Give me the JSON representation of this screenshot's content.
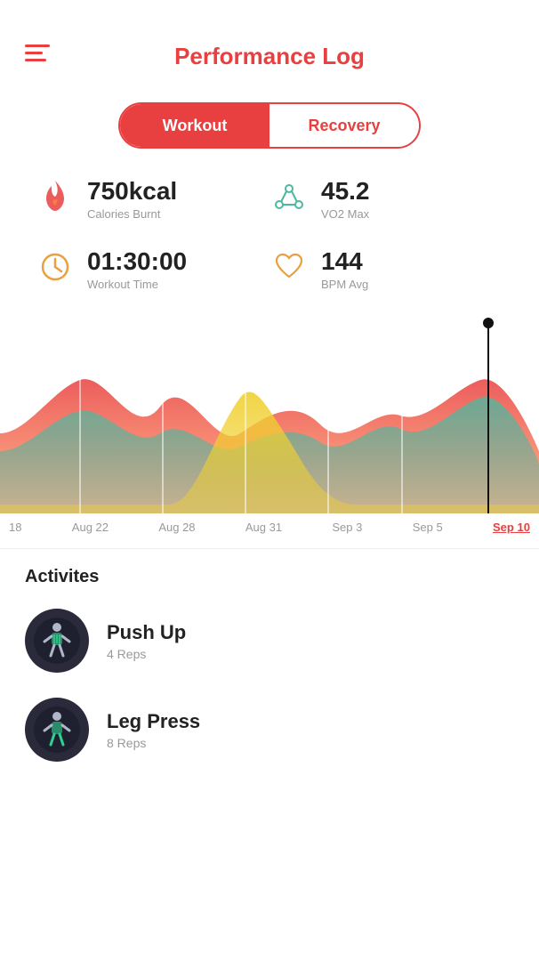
{
  "header": {
    "title": "Performance Log",
    "menu_icon": "menu-icon"
  },
  "tabs": {
    "workout_label": "Workout",
    "recovery_label": "Recovery",
    "active": "workout"
  },
  "stats": [
    {
      "value": "750kcal",
      "label": "Calories Burnt",
      "icon": "flame-icon",
      "icon_color": "#e84040"
    },
    {
      "value": "45.2",
      "label": "VO2 Max",
      "icon": "molecule-icon",
      "icon_color": "#4db8a0"
    },
    {
      "value": "01:30:00",
      "label": "Workout Time",
      "icon": "clock-icon",
      "icon_color": "#e8a040"
    },
    {
      "value": "144",
      "label": "BPM Avg",
      "icon": "heart-icon",
      "icon_color": "#e8a040"
    }
  ],
  "x_axis_labels": [
    "18",
    "Aug 22",
    "Aug 28",
    "Aug 31",
    "Sep 3",
    "Sep 5",
    "Sep 10"
  ],
  "activities": {
    "title": "Activites",
    "items": [
      {
        "name": "Push Up",
        "detail": "4 Reps",
        "avatar_type": "body-upper"
      },
      {
        "name": "Leg Press",
        "detail": "8 Reps",
        "avatar_type": "body-lower"
      }
    ]
  }
}
